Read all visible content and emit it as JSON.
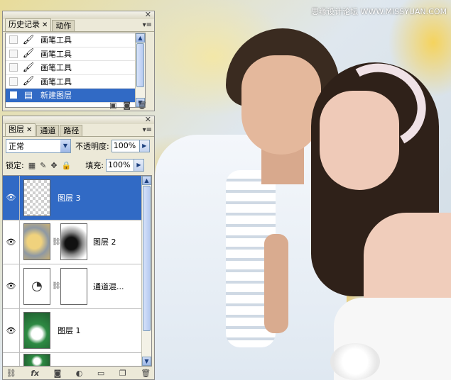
{
  "watermark": "思缘设计论坛 WWW.MISSYUAN.COM",
  "history_panel": {
    "tabs": [
      "历史记录",
      "动作"
    ],
    "items": [
      {
        "label": "画笔工具",
        "icon": "brush-icon",
        "selected": false
      },
      {
        "label": "画笔工具",
        "icon": "brush-icon",
        "selected": false
      },
      {
        "label": "画笔工具",
        "icon": "brush-icon",
        "selected": false
      },
      {
        "label": "画笔工具",
        "icon": "brush-icon",
        "selected": false
      },
      {
        "label": "新建图层",
        "icon": "new-layer-state-icon",
        "selected": true
      }
    ],
    "footer_icons": [
      "create-document-icon",
      "snapshot-icon",
      "trash-icon"
    ]
  },
  "layers_panel": {
    "tabs": [
      "图层",
      "通道",
      "路径"
    ],
    "blend_mode": "正常",
    "opacity_label": "不透明度:",
    "opacity_value": "100%",
    "lock_label": "锁定:",
    "fill_label": "填充:",
    "fill_value": "100%",
    "layers": [
      {
        "name": "图层 3",
        "selected": true,
        "visible": true
      },
      {
        "name": "图层 2",
        "selected": false,
        "visible": true
      },
      {
        "name": "通道混...",
        "selected": false,
        "visible": true
      },
      {
        "name": "图层 1",
        "selected": false,
        "visible": true
      }
    ],
    "footer_icons": [
      "link-icon",
      "fx-icon",
      "mask-icon",
      "adjustment-icon",
      "folder-icon",
      "new-layer-icon",
      "trash-icon"
    ],
    "fx_label": "fx"
  },
  "colors": {
    "selection": "#316ac5",
    "panel_bg": "#ece9d8"
  }
}
